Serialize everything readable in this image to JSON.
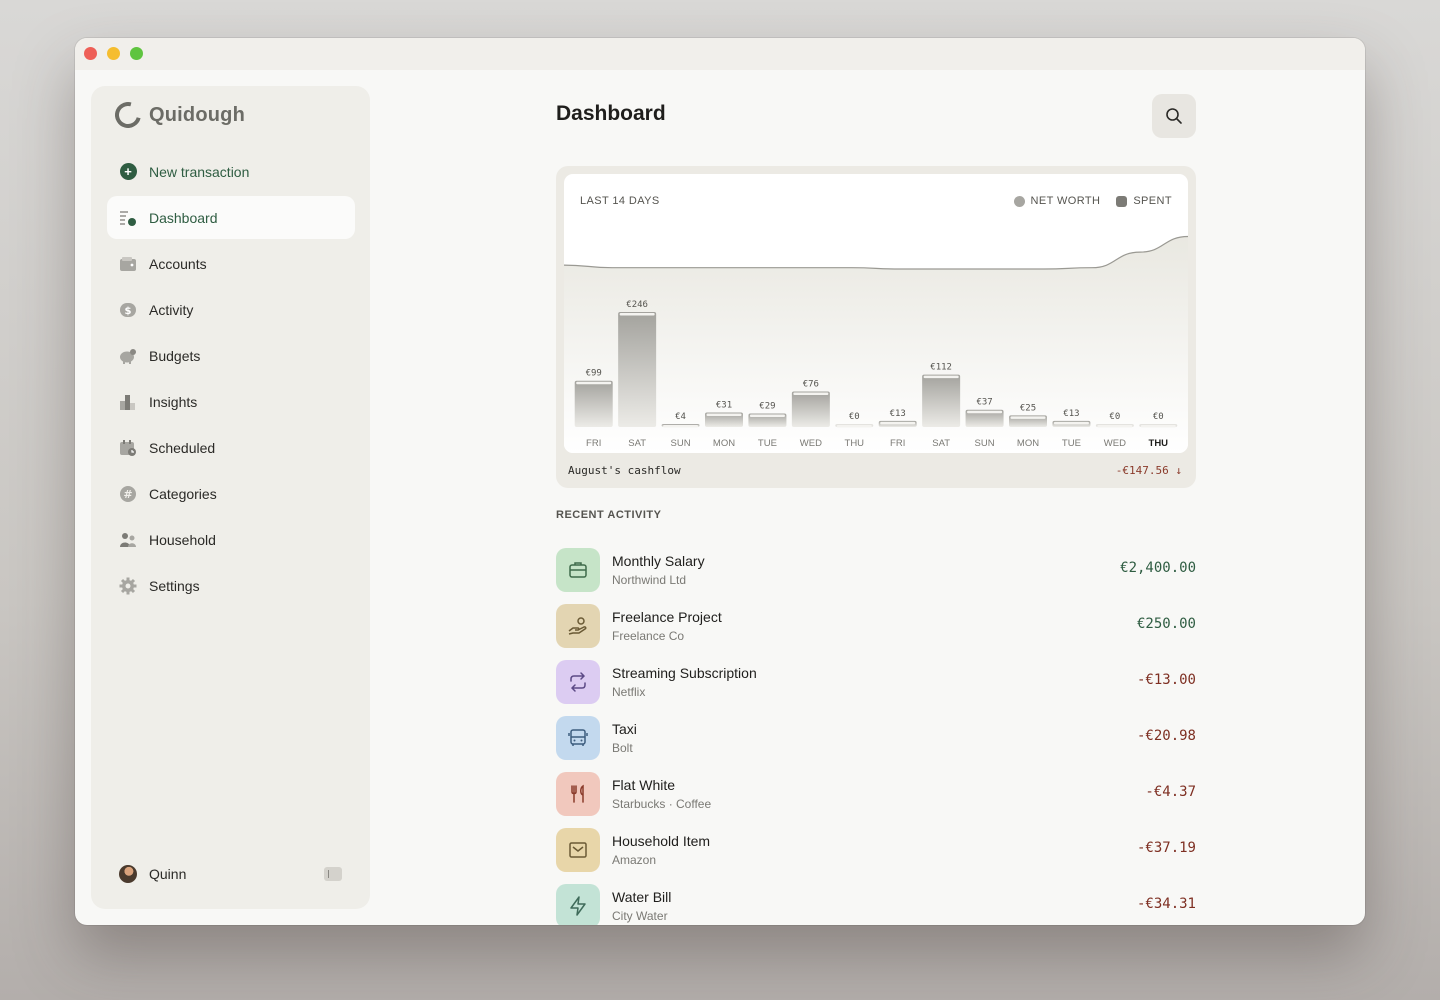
{
  "app": {
    "name": "Quidough",
    "window_controls": [
      "close",
      "minimize",
      "zoom"
    ]
  },
  "sidebar": {
    "items": [
      {
        "label": "New transaction",
        "icon": "plus-circle-icon",
        "kind": "action"
      },
      {
        "label": "Dashboard",
        "icon": "dashboard-icon",
        "active": true
      },
      {
        "label": "Accounts",
        "icon": "wallet-icon"
      },
      {
        "label": "Activity",
        "icon": "dollar-icon"
      },
      {
        "label": "Budgets",
        "icon": "piggy-bank-icon"
      },
      {
        "label": "Insights",
        "icon": "bar-chart-icon"
      },
      {
        "label": "Scheduled",
        "icon": "calendar-clock-icon"
      },
      {
        "label": "Categories",
        "icon": "hash-icon"
      },
      {
        "label": "Household",
        "icon": "people-icon"
      },
      {
        "label": "Settings",
        "icon": "gear-icon"
      }
    ],
    "user": {
      "name": "Quinn"
    }
  },
  "header": {
    "title": "Dashboard"
  },
  "chart": {
    "period_label": "LAST 14 DAYS",
    "legend": {
      "net_worth": "NET WORTH",
      "spent": "SPENT"
    },
    "cashflow_label": "August's cashflow",
    "cashflow_value": "-€147.56 ↓"
  },
  "chart_data": {
    "type": "bar",
    "categories": [
      "FRI",
      "SAT",
      "SUN",
      "MON",
      "TUE",
      "WED",
      "THU",
      "FRI",
      "SAT",
      "SUN",
      "MON",
      "TUE",
      "WED",
      "THU"
    ],
    "series": [
      {
        "name": "SPENT",
        "values": [
          99,
          246,
          4,
          31,
          29,
          76,
          0,
          13,
          112,
          37,
          25,
          13,
          0,
          0
        ]
      },
      {
        "name": "NET WORTH",
        "values": [
          0.55,
          0.54,
          0.54,
          0.54,
          0.54,
          0.54,
          0.54,
          0.535,
          0.535,
          0.535,
          0.535,
          0.54,
          0.6,
          0.66
        ]
      }
    ],
    "data_labels": [
      "€99",
      "€246",
      "€4",
      "€31",
      "€29",
      "€76",
      "€0",
      "€13",
      "€112",
      "€37",
      "€25",
      "€13",
      "€0",
      "€0"
    ],
    "highlight_index": 13,
    "colors": {
      "bar": "#a7a6a1",
      "bar_top": "#f4f3f0",
      "net_worth_line": "#9a9993",
      "area": "#efeee9"
    }
  },
  "recent_activity": {
    "title": "RECENT ACTIVITY",
    "items": [
      {
        "title": "Monthly Salary",
        "subtitle": "Northwind Ltd",
        "amount": "€2,400.00",
        "sign": "pos",
        "icon": "briefcase-icon",
        "color": "#c6e4c8",
        "icon_color": "#3f6b4a"
      },
      {
        "title": "Freelance Project",
        "subtitle": "Freelance Co",
        "amount": "€250.00",
        "sign": "pos",
        "icon": "hand-coin-icon",
        "color": "#e3d5b2",
        "icon_color": "#6a5a35"
      },
      {
        "title": "Streaming Subscription",
        "subtitle": "Netflix",
        "amount": "-€13.00",
        "sign": "neg",
        "icon": "repeat-icon",
        "color": "#dcccf2",
        "icon_color": "#5c4a86"
      },
      {
        "title": "Taxi",
        "subtitle": "Bolt",
        "amount": "-€20.98",
        "sign": "neg",
        "icon": "bus-icon",
        "color": "#c3d9ee",
        "icon_color": "#3d5d7e"
      },
      {
        "title": "Flat White",
        "subtitle": "Starbucks · Coffee",
        "amount": "-€4.37",
        "sign": "neg",
        "icon": "fork-knife-icon",
        "color": "#f1c8bd",
        "icon_color": "#8a3a2a"
      },
      {
        "title": "Household Item",
        "subtitle": "Amazon",
        "amount": "-€37.19",
        "sign": "neg",
        "icon": "package-icon",
        "color": "#e8d6a9",
        "icon_color": "#6a5a35"
      },
      {
        "title": "Water Bill",
        "subtitle": "City Water",
        "amount": "-€34.31",
        "sign": "neg",
        "icon": "lightning-icon",
        "color": "#c3e3d6",
        "icon_color": "#3f6b5a"
      }
    ]
  }
}
